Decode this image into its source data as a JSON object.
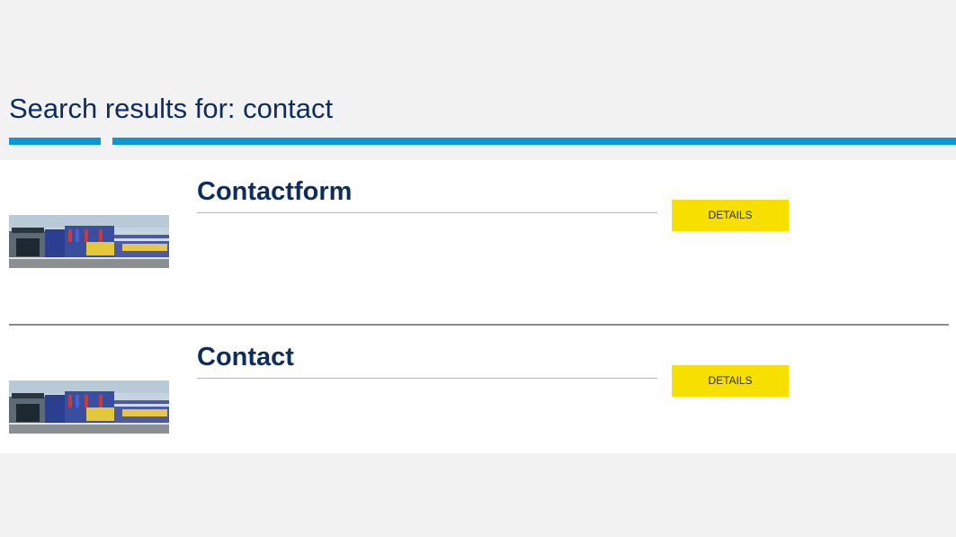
{
  "search": {
    "heading": "Search results for: contact"
  },
  "results": [
    {
      "title": "Contactform",
      "details_label": "DETAILS"
    },
    {
      "title": "Contact",
      "details_label": "DETAILS"
    }
  ],
  "colors": {
    "heading": "#0d2d5e",
    "accent_blue": "#0b98d8",
    "button_yellow": "#f7e000",
    "page_background": "#f2f2f2"
  }
}
